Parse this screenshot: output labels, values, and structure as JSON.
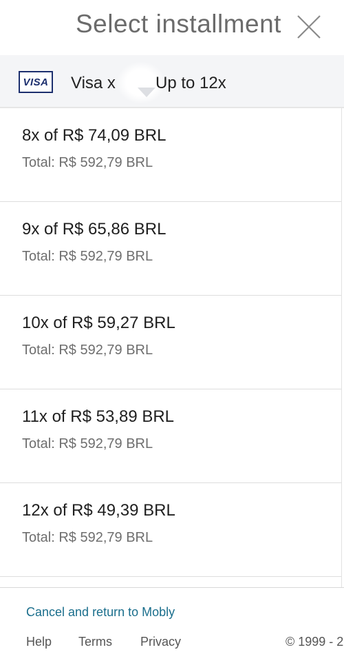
{
  "header": {
    "title": "Select installment",
    "close_icon": "close-icon"
  },
  "card": {
    "brand": "VISA",
    "label": "Visa x",
    "plan": "Up to 12x",
    "brand_color": "#1c2f6e"
  },
  "options": [
    {
      "installment": "8x of R$ 74,09 BRL",
      "total": "Total: R$ 592,79 BRL"
    },
    {
      "installment": "9x of R$ 65,86 BRL",
      "total": "Total: R$ 592,79 BRL"
    },
    {
      "installment": "10x of R$ 59,27 BRL",
      "total": "Total: R$ 592,79 BRL"
    },
    {
      "installment": "11x of R$ 53,89 BRL",
      "total": "Total: R$ 592,79 BRL"
    },
    {
      "installment": "12x of R$ 49,39 BRL",
      "total": "Total: R$ 592,79 BRL"
    }
  ],
  "footer": {
    "cancel_label": "Cancel and return to Mobly",
    "help_label": "Help",
    "terms_label": "Terms",
    "privacy_label": "Privacy",
    "copyright": "© 1999 - 2",
    "link_color": "#1a6e8c"
  }
}
